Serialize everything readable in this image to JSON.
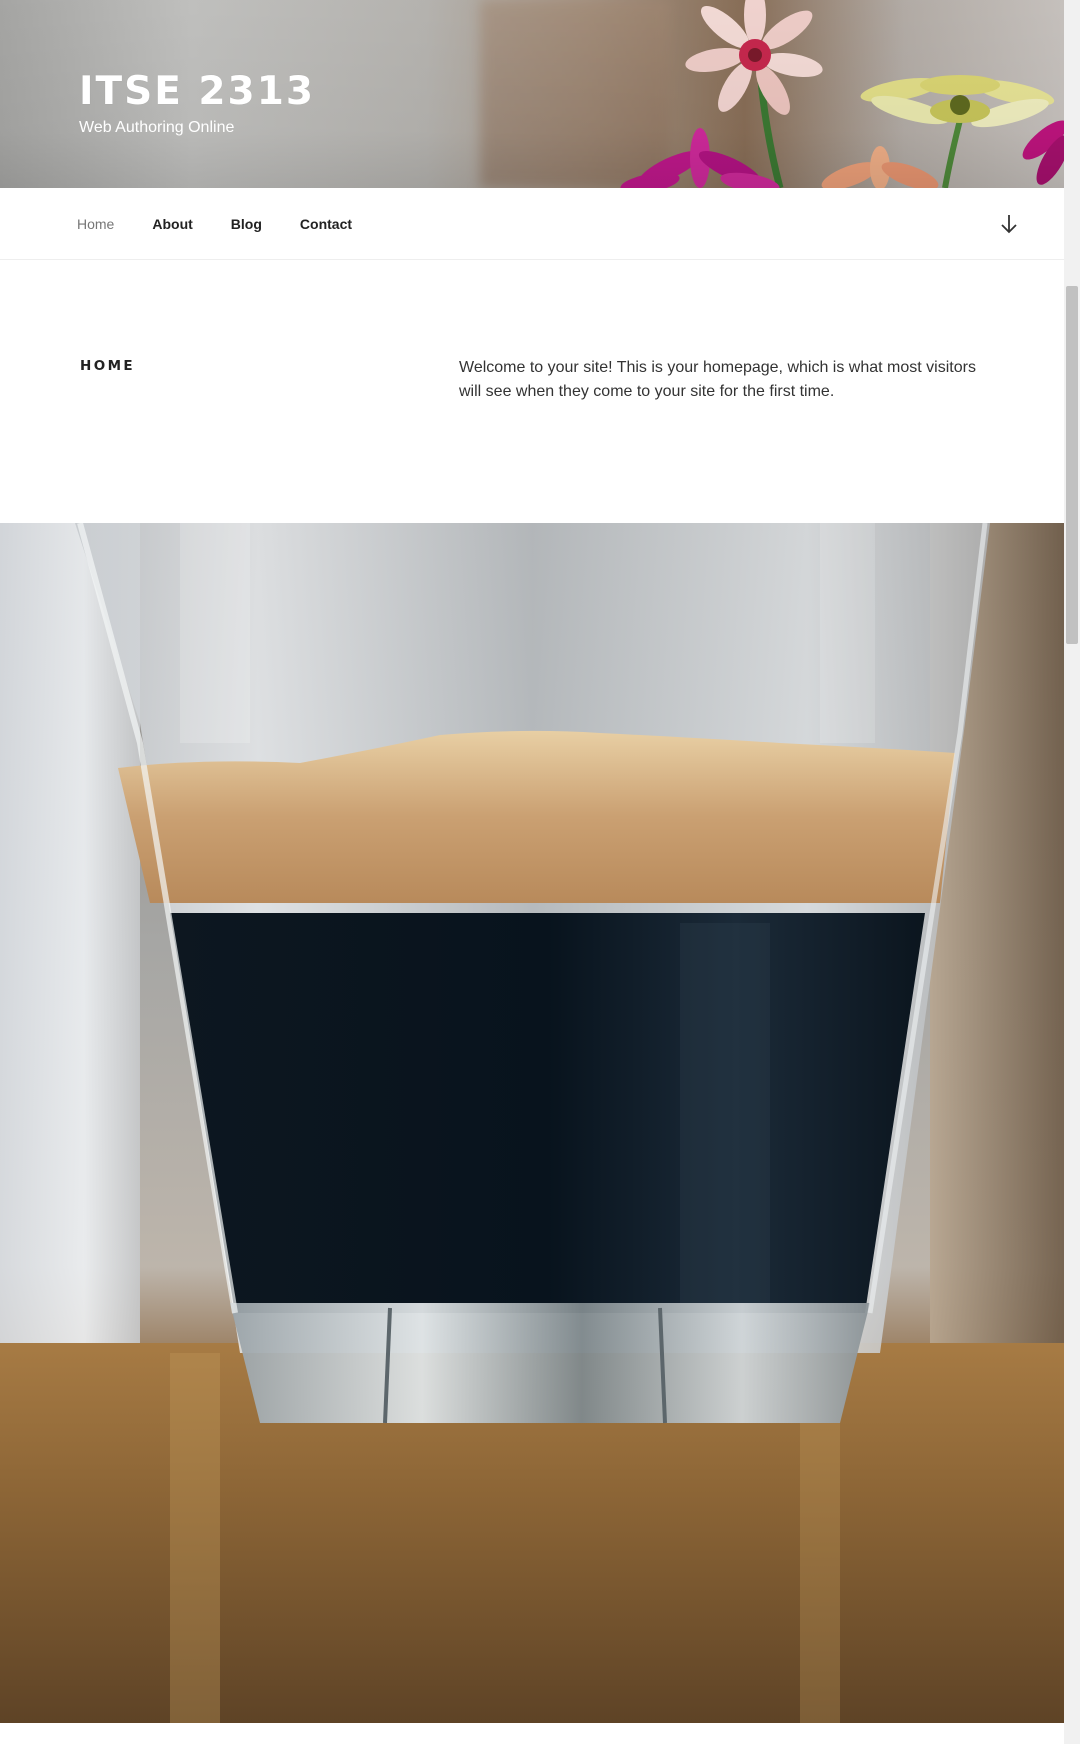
{
  "header": {
    "site_title": "ITSE 2313",
    "site_description": "Web Authoring Online"
  },
  "nav": {
    "items": [
      {
        "label": "Home",
        "current": true
      },
      {
        "label": "About",
        "current": false
      },
      {
        "label": "Blog",
        "current": false
      },
      {
        "label": "Contact",
        "current": false
      }
    ],
    "scroll_icon": "arrow-down-icon"
  },
  "page": {
    "title": "HOME",
    "body": "Welcome to your site! This is your homepage, which is what most visitors will see when they come to your site for the first time."
  },
  "featured_image": {
    "subject": "espresso-glass-image"
  },
  "colors": {
    "link_current": "#767676",
    "text": "#222222",
    "body_text": "#333333"
  }
}
